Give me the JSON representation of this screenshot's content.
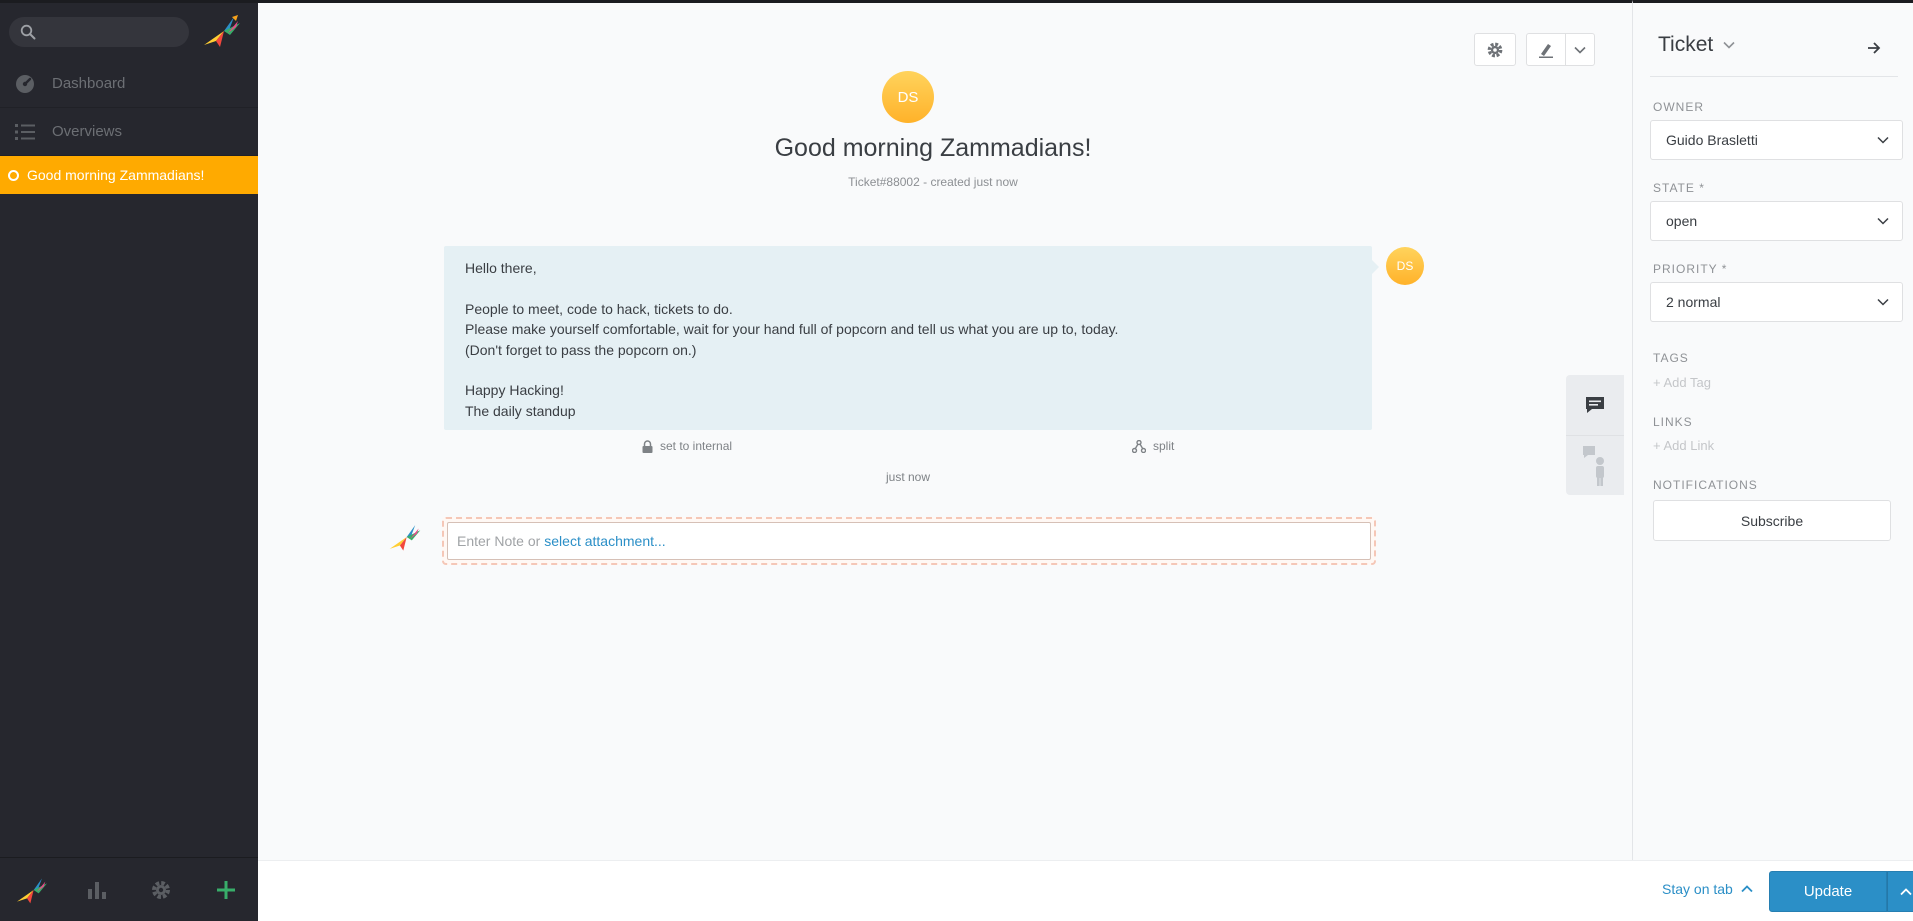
{
  "nav": {
    "search": {
      "placeholder": "",
      "value": ""
    },
    "items": [
      {
        "label": "Dashboard",
        "icon": "dashboard-icon"
      },
      {
        "label": "Overviews",
        "icon": "list-icon"
      }
    ],
    "active_task": "Good morning Zammadians!",
    "bottom_icons": [
      "logo-icon",
      "reports-icon",
      "settings-icon",
      "add-icon"
    ],
    "colors": {
      "bg": "#26272e",
      "active": "#ffaa00",
      "add": "#38ad69"
    }
  },
  "ticket": {
    "avatar_initials": "DS",
    "title": "Good morning Zammadians!",
    "meta": "Ticket#88002 - created just now"
  },
  "article": {
    "lines": [
      "Hello there,",
      "",
      "People to meet, code to hack, tickets to do.",
      "Please make yourself comfortable, wait for your hand full of popcorn and tell us what you are up to, today.",
      "(Don't forget to pass the popcorn on.)",
      "",
      "Happy Hacking!",
      "The daily standup"
    ],
    "avatar_initials": "DS",
    "actions": {
      "internal": "set to internal",
      "split": "split"
    },
    "time": "just now"
  },
  "reply": {
    "placeholder": "Enter Note or",
    "attachment_link": "select attachment..."
  },
  "sidebar": {
    "title": "Ticket",
    "owner": {
      "label": "OWNER",
      "value": "Guido Brasletti"
    },
    "state": {
      "label": "STATE *",
      "value": "open"
    },
    "priority": {
      "label": "PRIORITY *",
      "value": "2 normal"
    },
    "tags": {
      "label": "TAGS",
      "add": "+ Add Tag"
    },
    "links": {
      "label": "LINKS",
      "add": "+ Add Link"
    },
    "notifications": {
      "label": "NOTIFICATIONS",
      "button": "Subscribe"
    }
  },
  "bottom": {
    "stay_on_tab": "Stay on tab",
    "update": "Update",
    "accent": "#2b8fc7"
  }
}
